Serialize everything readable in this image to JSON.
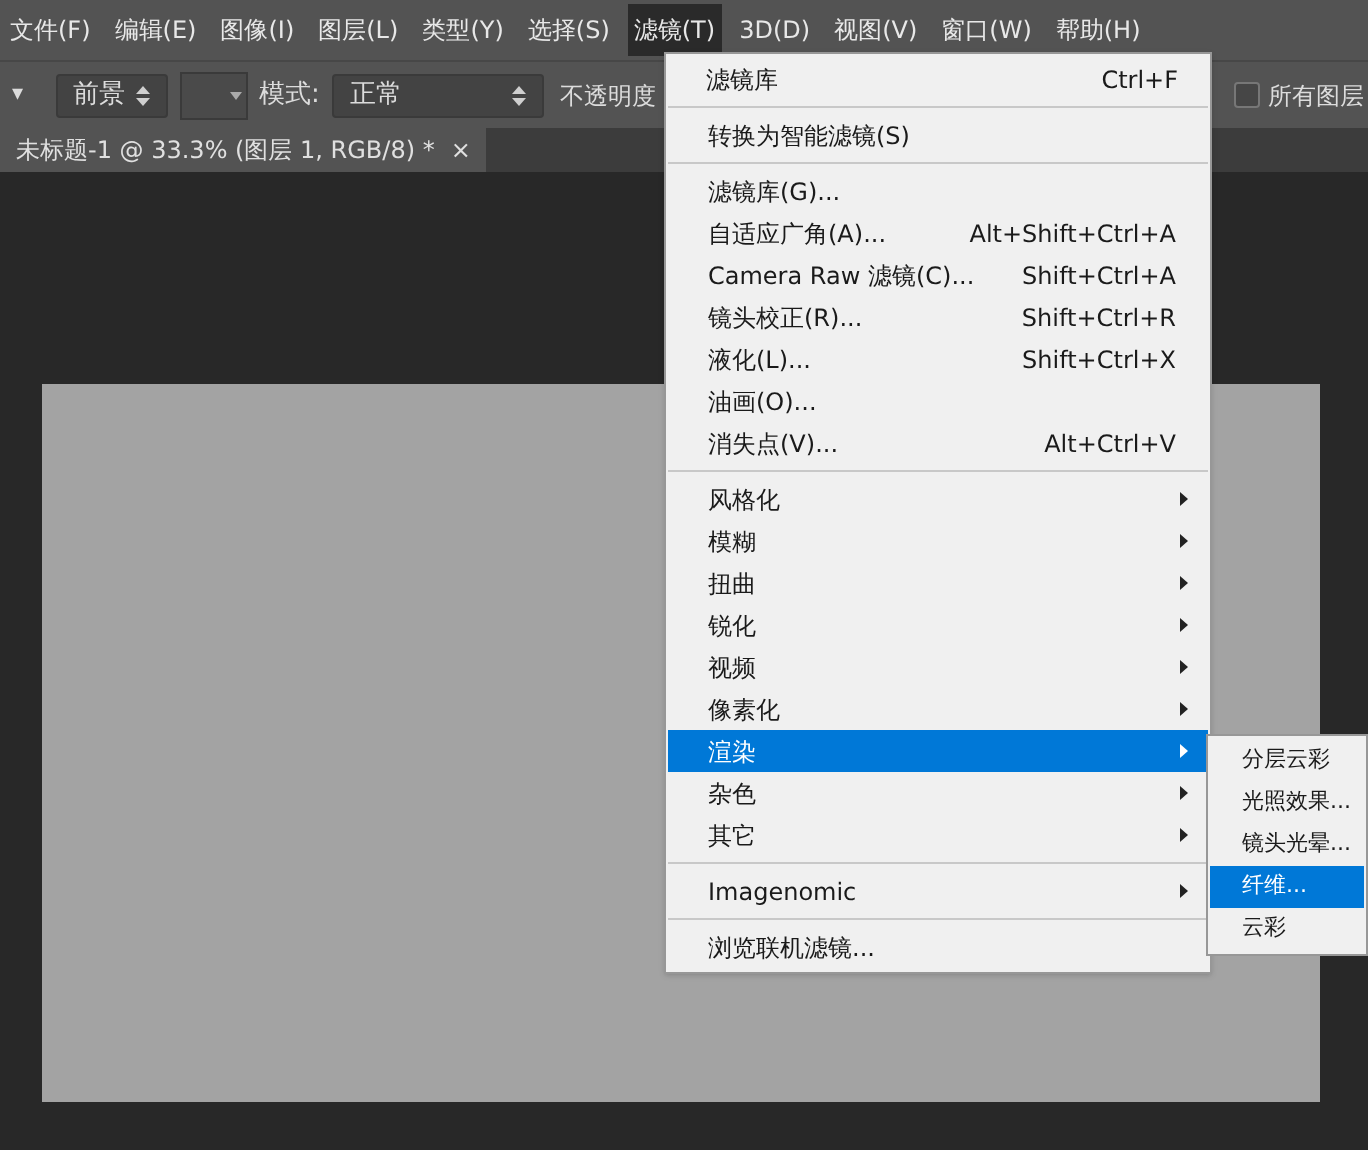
{
  "menubar": [
    {
      "label": "文件(F)",
      "selected": false
    },
    {
      "label": "编辑(E)",
      "selected": false
    },
    {
      "label": "图像(I)",
      "selected": false
    },
    {
      "label": "图层(L)",
      "selected": false
    },
    {
      "label": "类型(Y)",
      "selected": false
    },
    {
      "label": "选择(S)",
      "selected": false
    },
    {
      "label": "滤镜(T)",
      "selected": true
    },
    {
      "label": "3D(D)",
      "selected": false
    },
    {
      "label": "视图(V)",
      "selected": false
    },
    {
      "label": "窗口(W)",
      "selected": false
    },
    {
      "label": "帮助(H)",
      "selected": false
    }
  ],
  "options_bar": {
    "preset_caret": "▾",
    "source_select": "前景",
    "mode_label": "模式:",
    "mode_select": "正常",
    "opacity_label": "不透明度",
    "all_layers": {
      "label": "所有图层",
      "checked": false
    }
  },
  "document_tab": {
    "title": "未标题-1 @ 33.3% (图层 1, RGB/8) *",
    "close": "×"
  },
  "menu": {
    "groups": [
      [
        {
          "label": "滤镜库",
          "shortcut": "Ctrl+F",
          "submenu": false,
          "selected": false
        }
      ],
      [
        {
          "label": "转换为智能滤镜(S)",
          "submenu": false,
          "selected": false
        }
      ],
      [
        {
          "label": "滤镜库(G)...",
          "submenu": false,
          "selected": false
        },
        {
          "label": "自适应广角(A)...",
          "shortcut": "Alt+Shift+Ctrl+A",
          "submenu": false,
          "selected": false
        },
        {
          "label": "Camera Raw 滤镜(C)...",
          "shortcut": "Shift+Ctrl+A",
          "submenu": false,
          "selected": false
        },
        {
          "label": "镜头校正(R)...",
          "shortcut": "Shift+Ctrl+R",
          "submenu": false,
          "selected": false
        },
        {
          "label": "液化(L)...",
          "shortcut": "Shift+Ctrl+X",
          "submenu": false,
          "selected": false
        },
        {
          "label": "油画(O)...",
          "submenu": false,
          "selected": false
        },
        {
          "label": "消失点(V)...",
          "shortcut": "Alt+Ctrl+V",
          "submenu": false,
          "selected": false
        }
      ],
      [
        {
          "label": "风格化",
          "submenu": true,
          "selected": false
        },
        {
          "label": "模糊",
          "submenu": true,
          "selected": false
        },
        {
          "label": "扭曲",
          "submenu": true,
          "selected": false
        },
        {
          "label": "锐化",
          "submenu": true,
          "selected": false
        },
        {
          "label": "视频",
          "submenu": true,
          "selected": false
        },
        {
          "label": "像素化",
          "submenu": true,
          "selected": false
        },
        {
          "label": "渲染",
          "submenu": true,
          "selected": true
        },
        {
          "label": "杂色",
          "submenu": true,
          "selected": false
        },
        {
          "label": "其它",
          "submenu": true,
          "selected": false
        }
      ],
      [
        {
          "label": "Imagenomic",
          "submenu": true,
          "selected": false
        }
      ],
      [
        {
          "label": "浏览联机滤镜...",
          "submenu": false,
          "selected": false
        }
      ]
    ]
  },
  "submenu": [
    {
      "label": "分层云彩",
      "selected": false
    },
    {
      "label": "光照效果...",
      "selected": false
    },
    {
      "label": "镜头光晕...",
      "selected": false
    },
    {
      "label": "纤维...",
      "selected": true
    },
    {
      "label": "云彩",
      "selected": false
    }
  ]
}
